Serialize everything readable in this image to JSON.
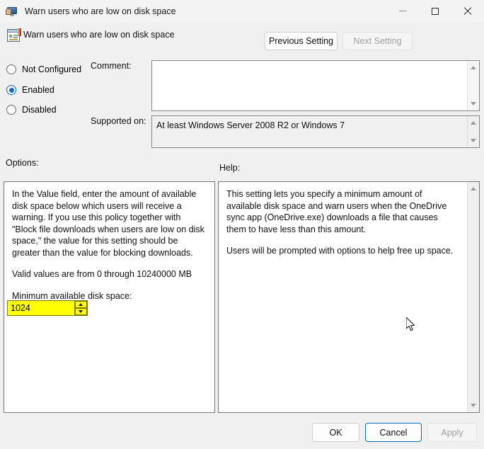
{
  "window": {
    "title": "Warn users who are low on disk space",
    "icon": "monitor-user-icon",
    "controls": {
      "minimize": "minimize-icon",
      "maximize": "maximize-icon",
      "close": "close-icon"
    }
  },
  "header": {
    "setting_name": "Warn users who are low on disk space",
    "icon": "policy-setting-icon",
    "prev_button": "Previous Setting",
    "next_button": "Next Setting",
    "prev_enabled": true,
    "next_enabled": false
  },
  "state": {
    "options": [
      {
        "label": "Not Configured",
        "selected": false
      },
      {
        "label": "Enabled",
        "selected": true
      },
      {
        "label": "Disabled",
        "selected": false
      }
    ]
  },
  "comment": {
    "label": "Comment:",
    "value": "",
    "placeholder": ""
  },
  "supported_on": {
    "label": "Supported on:",
    "value": "At least Windows Server 2008 R2 or Windows 7"
  },
  "options_panel": {
    "label": "Options:",
    "paragraphs": [
      "In the Value field, enter the amount of available disk space below which users will receive a warning. If you use this policy together with \"Block file downloads when users are low on disk space,\" the value for this setting should be greater than the value for blocking downloads.",
      "Valid values are from 0 through 10240000 MB"
    ],
    "field_label": "Minimum available disk space:",
    "field_value": "1024",
    "field_highlight_color": "#ffff00"
  },
  "help_panel": {
    "label": "Help:",
    "paragraphs": [
      "This setting lets you specify a minimum amount of available disk space and warn users when the OneDrive sync app (OneDrive.exe) downloads a file that causes them to have less than this amount.",
      "Users will be prompted with options to help free up space."
    ]
  },
  "footer": {
    "ok": "OK",
    "cancel": "Cancel",
    "apply": "Apply",
    "apply_enabled": false,
    "focused_button": "Cancel"
  },
  "colors": {
    "accent": "#0f6cbd",
    "window_bg": "#f0f0f0",
    "titlebar_bg": "#f3f3f3",
    "highlight": "#ffff00"
  }
}
